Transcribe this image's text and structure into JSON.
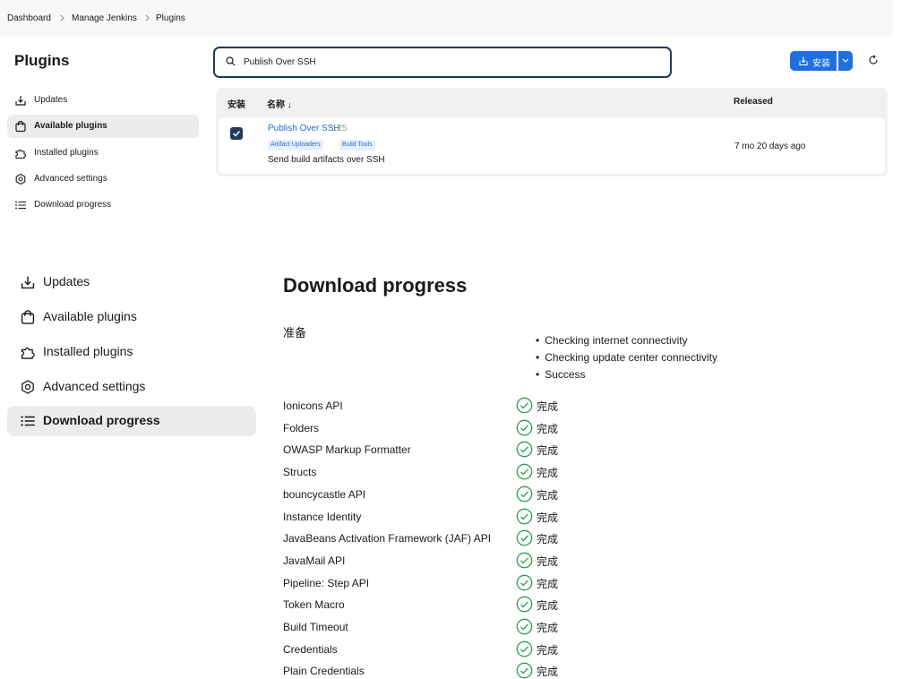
{
  "breadcrumb": {
    "items": [
      "Dashboard",
      "Manage Jenkins",
      "Plugins"
    ]
  },
  "plugins_page": {
    "title": "Plugins",
    "sidebar": [
      {
        "label": "Updates",
        "icon": "download-tray-icon",
        "active": false
      },
      {
        "label": "Available plugins",
        "icon": "shopping-bag-icon",
        "active": true
      },
      {
        "label": "Installed plugins",
        "icon": "puzzle-icon",
        "active": false
      },
      {
        "label": "Advanced settings",
        "icon": "gear-icon",
        "active": false
      },
      {
        "label": "Download progress",
        "icon": "list-icon",
        "active": false
      }
    ],
    "search": {
      "value": "Publish Over SSH",
      "icon": "search-icon"
    },
    "install_button": {
      "label": "安装",
      "icon": "install-icon",
      "color": "#1f6fe0"
    },
    "table": {
      "headers": {
        "install": "安装",
        "name": "名称 ↓",
        "released": "Released"
      },
      "rows": [
        {
          "checked": true,
          "name": "Publish Over SSH",
          "version": "1.25",
          "tags": [
            "Artifact Uploaders",
            "Build Tools"
          ],
          "description": "Send build artifacts over SSH",
          "released": "7 mo 20 days ago"
        }
      ]
    }
  },
  "download_page": {
    "sidebar": [
      {
        "label": "Updates",
        "icon": "download-tray-icon",
        "active": false
      },
      {
        "label": "Available plugins",
        "icon": "shopping-bag-icon",
        "active": false
      },
      {
        "label": "Installed plugins",
        "icon": "puzzle-icon",
        "active": false
      },
      {
        "label": "Advanced settings",
        "icon": "gear-icon",
        "active": false
      },
      {
        "label": "Download progress",
        "icon": "list-icon",
        "active": true
      }
    ],
    "title": "Download progress",
    "preparation": {
      "label": "准备",
      "steps": [
        "Checking internet connectivity",
        "Checking update center connectivity",
        "Success"
      ]
    },
    "status_label": "完成",
    "status_color": "#2e9e4f",
    "plugins": [
      "Ionicons API",
      "Folders",
      "OWASP Markup Formatter",
      "Structs",
      "bouncycastle API",
      "Instance Identity",
      "JavaBeans Activation Framework (JAF) API",
      "JavaMail API",
      "Pipeline: Step API",
      "Token Macro",
      "Build Timeout",
      "Credentials",
      "Plain Credentials"
    ]
  }
}
